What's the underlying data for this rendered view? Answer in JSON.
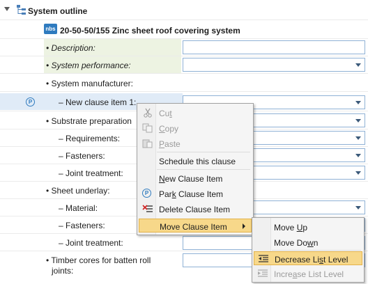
{
  "outline": {
    "title": "System outline",
    "tree_icon": "tree-hierarchy-icon",
    "expand_icon": "collapse-triangle-icon"
  },
  "clause": {
    "badge": "nbs",
    "title": "20-50-50/155  Zinc sheet roof covering system"
  },
  "rows": [
    {
      "label": "• Description:",
      "italic": true
    },
    {
      "label": "• System performance:",
      "italic": true
    },
    {
      "label": "• System manufacturer:"
    },
    {
      "label": "– New clause item 1:"
    },
    {
      "label": "• Substrate preparation"
    },
    {
      "label": "– Requirements:"
    },
    {
      "label": "– Fasteners:"
    },
    {
      "label": "– Joint treatment:"
    },
    {
      "label": "• Sheet underlay:"
    },
    {
      "label": "– Material:"
    },
    {
      "label": "– Fasteners:"
    },
    {
      "label": "– Joint treatment:"
    },
    {
      "label": "• Timber cores for batten roll"
    },
    {
      "label": "joints:"
    }
  ],
  "parked_marker": "P",
  "context_menu": {
    "cut": {
      "pre": "Cu",
      "u": "t",
      "post": ""
    },
    "copy": {
      "pre": "",
      "u": "C",
      "post": "opy"
    },
    "paste": {
      "pre": "",
      "u": "P",
      "post": "aste"
    },
    "schedule": "Schedule this clause",
    "new_item": {
      "pre": "",
      "u": "N",
      "post": "ew Clause Item"
    },
    "park_item": {
      "pre": "Par",
      "u": "k",
      "post": " Clause Item"
    },
    "delete_item": "Delete Clause Item",
    "move_item": "Move Clause Item"
  },
  "submenu": {
    "move_up": {
      "pre": "Move ",
      "u": "U",
      "post": "p"
    },
    "move_down": {
      "pre": "Move Do",
      "u": "w",
      "post": "n"
    },
    "decrease": {
      "pre": "Decrease Li",
      "u": "s",
      "post": "t Level"
    },
    "increase": {
      "pre": "Incre",
      "u": "a",
      "post": "se List Level"
    }
  },
  "colors": {
    "highlight": "#f7d88a",
    "selection": "#e0ebf7",
    "green_band": "#edf3e2",
    "accent": "#2f7bbf"
  }
}
